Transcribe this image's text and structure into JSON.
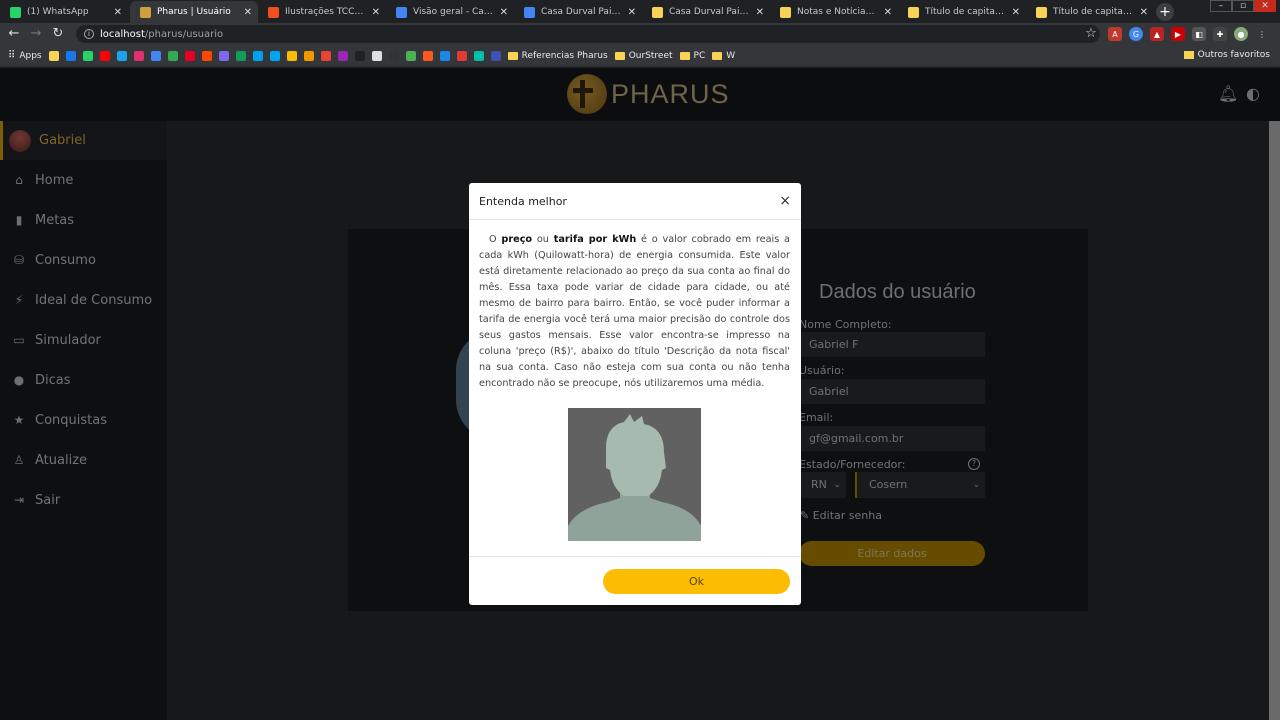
{
  "browser": {
    "tabs": [
      {
        "title": "(1) WhatsApp",
        "color": "#25d366"
      },
      {
        "title": "Pharus | Usuário",
        "color": "#d0a040"
      },
      {
        "title": "Ilustrações TCC – Figma",
        "color": "#f24e1e"
      },
      {
        "title": "Visão geral - Casa Durval",
        "color": "#4285f4"
      },
      {
        "title": "Casa Durval Paiva - Goo",
        "color": "#4285f4"
      },
      {
        "title": "Casa Durval Paiva",
        "color": "#f7d454"
      },
      {
        "title": "Notas e Notícias - Casa",
        "color": "#f7d454"
      },
      {
        "title": "Título de capitalização",
        "color": "#f7d454"
      },
      {
        "title": "Título de capitalização",
        "color": "#f7d454"
      }
    ],
    "close_glyph": "✕",
    "new_tab": "+",
    "url_host": "localhost",
    "url_path": "/pharus/usuario",
    "bookmarks_apps": "Apps",
    "bookmarks": [
      "Referencias Pharus",
      "OurStreet",
      "PC",
      "W"
    ],
    "bookmarks_other": "Outros favoritos"
  },
  "app": {
    "logo_text": "PHARUS",
    "user_name": "Gabriel",
    "nav": [
      {
        "label": "Home",
        "icon": "home-icon",
        "glyph": "⌂"
      },
      {
        "label": "Metas",
        "icon": "bookmark-icon",
        "glyph": "▮"
      },
      {
        "label": "Consumo",
        "icon": "coins-icon",
        "glyph": "⛁"
      },
      {
        "label": "Ideal de Consumo",
        "icon": "plug-icon",
        "glyph": "⚡"
      },
      {
        "label": "Simulador",
        "icon": "monitor-icon",
        "glyph": "▭"
      },
      {
        "label": "Dicas",
        "icon": "lightbulb-icon",
        "glyph": "●"
      },
      {
        "label": "Conquistas",
        "icon": "star-icon",
        "glyph": "★"
      },
      {
        "label": "Atualize",
        "icon": "user-edit-icon",
        "glyph": "♙"
      },
      {
        "label": "Sair",
        "icon": "sign-out-icon",
        "glyph": "⇥"
      }
    ]
  },
  "form": {
    "title": "Dados do usuário",
    "full_name_label": "Nome Completo:",
    "full_name_value": "Gabriel F",
    "username_label": "Usuário:",
    "username_value": "Gabriel",
    "email_label": "Email:",
    "email_value": "gf@gmail.com.br",
    "state_label": "Estado/Fornecedor:",
    "state_value": "RN",
    "provider_value": "Cosern",
    "edit_password": "Editar senha",
    "edit_button": "Editar dados"
  },
  "modal": {
    "title": "Entenda melhor",
    "close": "×",
    "text_pre": "O ",
    "bold1": "preço",
    "text_mid1": " ou ",
    "bold2": "tarifa por kWh",
    "text_rest": " é o valor cobrado em reais a cada kWh (Quilowatt-hora) de energia consumida. Este valor está diretamente relacionado ao preço da sua conta ao final do mês. Essa taxa pode variar de cidade para cidade, ou até mesmo de bairro para bairro. Então, se você puder informar a tarifa de energia você terá uma maior precisão do controle dos seus gastos mensais. Esse valor encontra-se impresso na coluna 'preço (R$)', abaixo do título 'Descrição da nota fiscal' na sua conta. Caso não esteja com sua conta ou não tenha encontrado não se preocupe, nós utilizaremos uma média.",
    "ok_button": "Ok"
  },
  "colors": {
    "accent": "#fcbc02",
    "sidebar_bg": "#1a1c1f",
    "main_bg": "#2a2c30"
  }
}
